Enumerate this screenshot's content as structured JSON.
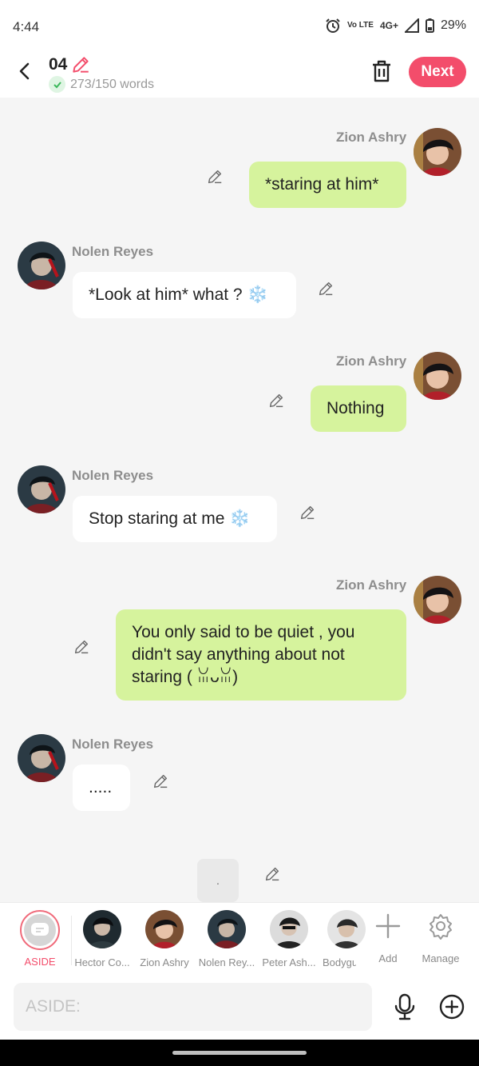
{
  "status": {
    "time": "4:44",
    "network": "4G+",
    "volte": "Vo LTE",
    "battery": "29%"
  },
  "header": {
    "title": "04",
    "word_count": "273/150 words",
    "next_label": "Next"
  },
  "messages": [
    {
      "sender": "Zion Ashry",
      "text": "*staring at him*"
    },
    {
      "sender": "Nolen Reyes",
      "text": "*Look at him* what ? ❄️"
    },
    {
      "sender": "Zion Ashry",
      "text": "Nothing"
    },
    {
      "sender": "Nolen Reyes",
      "text": "Stop staring at me ❄️"
    },
    {
      "sender": "Zion Ashry",
      "text": "You only said to be quiet , you didn't say anything about not staring ( ꈍᴗꈍ)"
    },
    {
      "sender": "Nolen Reyes",
      "text": "....."
    }
  ],
  "typing": {
    "text": "."
  },
  "characters": [
    {
      "label": "ASIDE"
    },
    {
      "label": "Hector Co..."
    },
    {
      "label": "Zion Ashry"
    },
    {
      "label": "Nolen Rey..."
    },
    {
      "label": "Peter Ash..."
    },
    {
      "label": "Bodygu"
    },
    {
      "label": "Add"
    },
    {
      "label": "Manage"
    }
  ],
  "input": {
    "placeholder": "ASIDE:"
  },
  "colors": {
    "accent": "#f34d6b",
    "my_bubble": "#d6f39d",
    "their_bubble": "#ffffff",
    "background": "#f5f5f5"
  },
  "icons": [
    "back-arrow-icon",
    "edit-pencil-icon",
    "check-icon",
    "trash-icon",
    "mic-icon",
    "plus-circle-icon",
    "gear-icon",
    "add-icon",
    "alarm-icon",
    "signal-icon",
    "battery-icon"
  ]
}
